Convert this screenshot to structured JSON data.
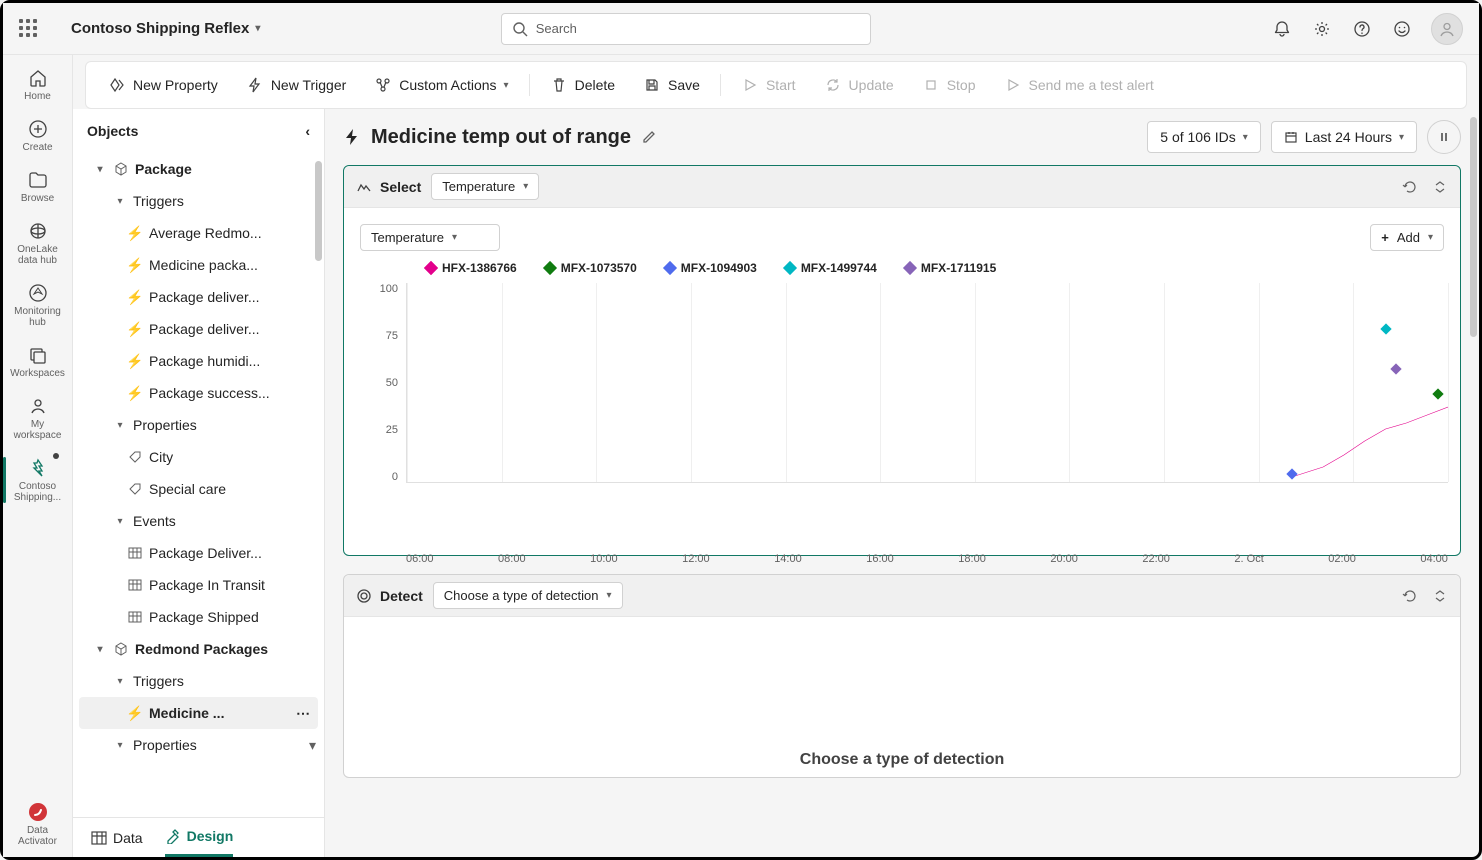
{
  "header": {
    "workspace": "Contoso Shipping Reflex",
    "search_placeholder": "Search"
  },
  "rail": {
    "home": "Home",
    "create": "Create",
    "browse": "Browse",
    "onelake": "OneLake data hub",
    "monitoring": "Monitoring hub",
    "workspaces": "Workspaces",
    "my_workspace": "My workspace",
    "active_ws": "Contoso Shipping...",
    "data_activator": "Data Activator"
  },
  "toolbar": {
    "new_property": "New Property",
    "new_trigger": "New Trigger",
    "custom_actions": "Custom Actions",
    "delete": "Delete",
    "save": "Save",
    "start": "Start",
    "update": "Update",
    "stop": "Stop",
    "send_test": "Send me a test alert"
  },
  "objects": {
    "title": "Objects",
    "package": "Package",
    "triggers": "Triggers",
    "package_triggers": [
      "Average Redmo...",
      "Medicine packa...",
      "Package deliver...",
      "Package deliver...",
      "Package humidi...",
      "Package success..."
    ],
    "properties": "Properties",
    "city": "City",
    "special_care": "Special care",
    "events": "Events",
    "package_events": [
      "Package Deliver...",
      "Package In Transit",
      "Package Shipped"
    ],
    "redmond": "Redmond Packages",
    "medicine_short": "Medicine ...",
    "properties2": "Properties"
  },
  "page": {
    "title": "Medicine temp out of range",
    "ids": "5 of 106 IDs",
    "time_range": "Last 24 Hours"
  },
  "select_card": {
    "title": "Select",
    "dropdown": "Temperature",
    "property": "Temperature",
    "add": "Add"
  },
  "detect_card": {
    "title": "Detect",
    "dropdown": "Choose a type of detection",
    "placeholder": "Choose a type of detection"
  },
  "bottom_tabs": {
    "data": "Data",
    "design": "Design"
  },
  "chart_data": {
    "type": "line",
    "title": "",
    "xlabel": "",
    "ylabel": "",
    "ylim": [
      0,
      100
    ],
    "y_ticks": [
      100,
      75,
      50,
      25,
      0
    ],
    "x_ticks": [
      "06:00",
      "08:00",
      "10:00",
      "12:00",
      "14:00",
      "16:00",
      "18:00",
      "20:00",
      "22:00",
      "2. Oct",
      "02:00",
      "04:00"
    ],
    "series": [
      {
        "name": "HFX-1386766",
        "color": "#e3008c",
        "type": "line",
        "points": [
          {
            "x": 85,
            "y": 3
          },
          {
            "x": 88,
            "y": 8
          },
          {
            "x": 90,
            "y": 14
          },
          {
            "x": 92,
            "y": 21
          },
          {
            "x": 94,
            "y": 27
          },
          {
            "x": 96,
            "y": 30
          },
          {
            "x": 98,
            "y": 34
          },
          {
            "x": 100,
            "y": 38
          }
        ]
      },
      {
        "name": "MFX-1073570",
        "color": "#107c10",
        "type": "point",
        "points": [
          {
            "x": 99,
            "y": 44
          }
        ]
      },
      {
        "name": "MFX-1094903",
        "color": "#4f6bed",
        "type": "point",
        "points": [
          {
            "x": 85,
            "y": 4
          }
        ]
      },
      {
        "name": "MFX-1499744",
        "color": "#00b7c3",
        "type": "point",
        "points": [
          {
            "x": 94,
            "y": 77
          }
        ]
      },
      {
        "name": "MFX-1711915",
        "color": "#8764b8",
        "type": "point",
        "points": [
          {
            "x": 95,
            "y": 57
          }
        ]
      }
    ]
  }
}
